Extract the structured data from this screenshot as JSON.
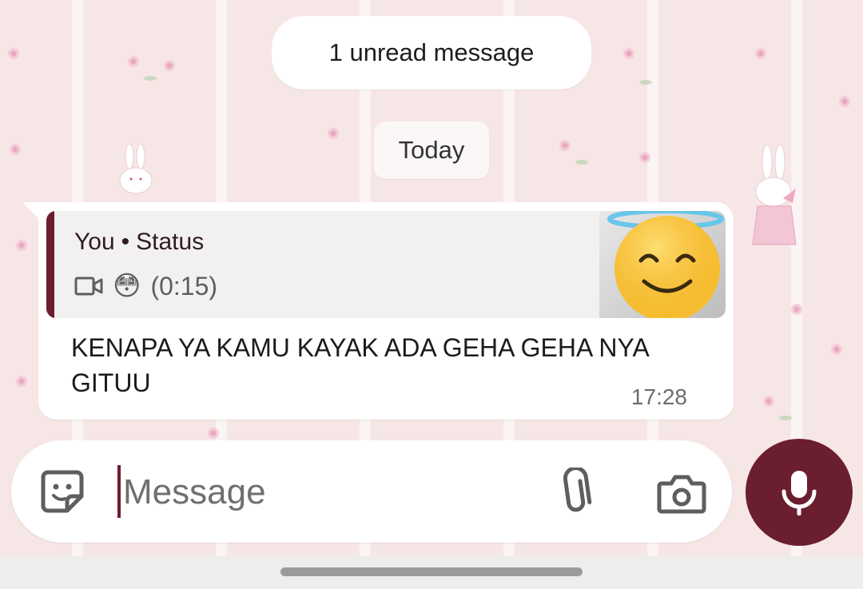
{
  "chat": {
    "unread_banner": "1 unread message",
    "date_separator": "Today"
  },
  "message": {
    "reply": {
      "author": "You",
      "separator": "•",
      "context": "Status",
      "media_icon": "video-icon",
      "emoji": "😳",
      "duration": "(0:15)",
      "thumbnail_overlay_emoji": "😇"
    },
    "text": "KENAPA YA KAMU KAYAK ADA GEHA GEHA NYA GITUU",
    "time": "17:28"
  },
  "composer": {
    "placeholder": "Message",
    "sticker_icon": "sticker-icon",
    "attach_icon": "paperclip-icon",
    "camera_icon": "camera-icon",
    "mic_icon": "microphone-icon"
  },
  "colors": {
    "accent": "#6b1e2e",
    "bubble": "#ffffff",
    "reply_card": "#f3f1f0",
    "wallpaper": "#f7e6e6"
  }
}
